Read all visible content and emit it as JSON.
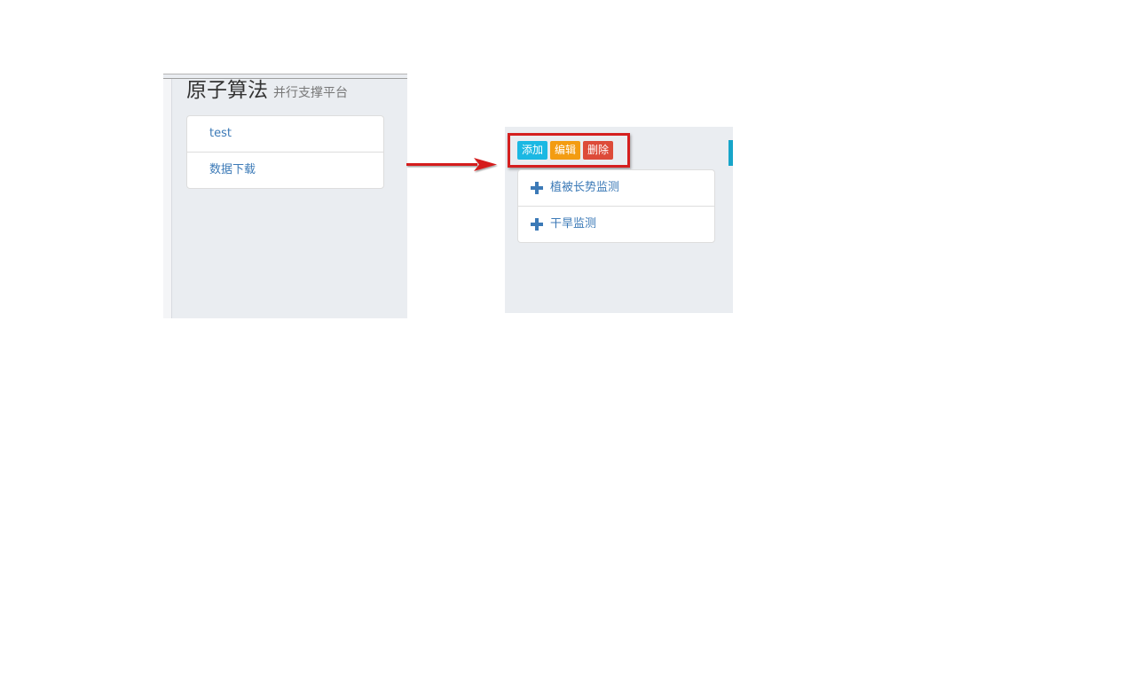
{
  "left_panel": {
    "title": "原子算法",
    "subtitle": "并行支撑平台",
    "items": [
      {
        "label": "test"
      },
      {
        "label": "数据下载"
      }
    ]
  },
  "right_panel": {
    "toolbar": {
      "add_label": "添加",
      "edit_label": "编辑",
      "delete_label": "删除"
    },
    "items": [
      {
        "label": "植被长势监测",
        "icon": "plus-icon"
      },
      {
        "label": "干旱监测",
        "icon": "plus-icon"
      }
    ]
  },
  "colors": {
    "panel_bg": "#eaedf1",
    "link": "#3c7ab7",
    "add": "#1bb8e3",
    "edit": "#f39c12",
    "delete": "#dd4b39",
    "highlight": "#d51f1f",
    "accent": "#17a5c9"
  }
}
